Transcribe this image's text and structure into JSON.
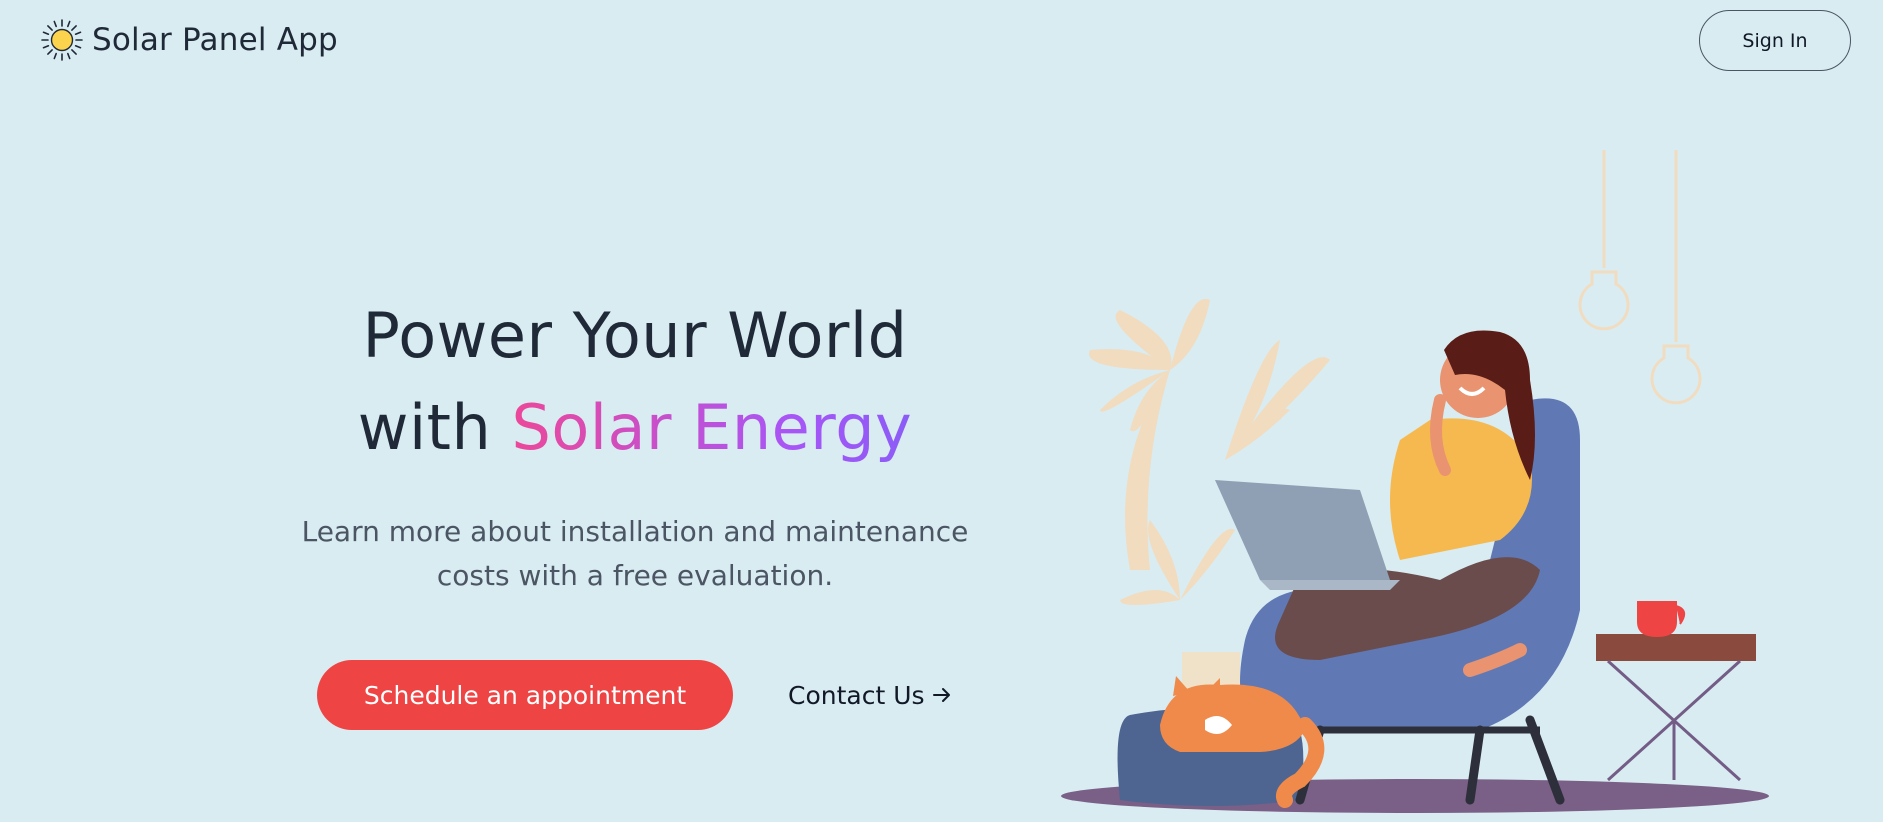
{
  "header": {
    "brand": "Solar Panel App",
    "logo_icon": "sun-icon",
    "signin_label": "Sign In"
  },
  "hero": {
    "headline_line1": "Power Your World",
    "headline_line2_prefix": "with ",
    "headline_line2_accent": "Solar Energy",
    "subtitle_line1": "Learn more about installation and maintenance",
    "subtitle_line2": "costs with a free evaluation.",
    "cta_label": "Schedule an appointment",
    "contact_label": "Contact Us",
    "contact_icon": "arrow-right-icon"
  },
  "colors": {
    "background": "#d9ecf2",
    "cta": "#ef4444",
    "accent_gradient_start": "#ec4899",
    "accent_gradient_end": "#8b5cf6",
    "text_dark": "#1f2937"
  },
  "illustration": {
    "subject": "woman-on-armchair-with-laptop-illustration"
  }
}
